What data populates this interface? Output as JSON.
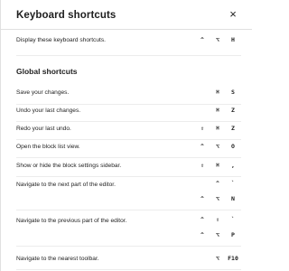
{
  "dialog": {
    "title": "Keyboard shortcuts",
    "close_label": "×"
  },
  "intro": {
    "desc": "Display these keyboard shortcuts.",
    "keys": [
      [
        "^",
        "⌥",
        "H"
      ]
    ]
  },
  "global": {
    "title": "Global shortcuts",
    "rows": [
      {
        "desc": "Save your changes.",
        "keys": [
          [
            "⌘",
            "S"
          ]
        ]
      },
      {
        "desc": "Undo your last changes.",
        "keys": [
          [
            "⌘",
            "Z"
          ]
        ]
      },
      {
        "desc": "Redo your last undo.",
        "keys": [
          [
            "⇧",
            "⌘",
            "Z"
          ]
        ]
      },
      {
        "desc": "Open the block list view.",
        "keys": [
          [
            "^",
            "⌥",
            "O"
          ]
        ]
      },
      {
        "desc": "Show or hide the block settings sidebar.",
        "keys": [
          [
            "⇧",
            "⌘",
            ","
          ]
        ]
      },
      {
        "desc": "Navigate to the next part of the editor.",
        "keys": [
          [
            "^",
            "`"
          ],
          [
            "^",
            "⌥",
            "N"
          ]
        ]
      },
      {
        "desc": "Navigate to the previous part of the editor.",
        "keys": [
          [
            "^",
            "⇧",
            "`"
          ],
          [
            "^",
            "⌥",
            "P"
          ]
        ]
      },
      {
        "desc": "Navigate to the nearest toolbar.",
        "keys": [
          [
            "⌥",
            "F10"
          ]
        ]
      }
    ]
  }
}
